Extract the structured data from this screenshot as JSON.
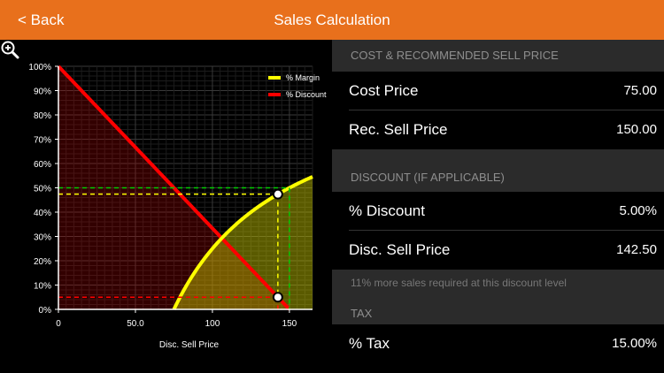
{
  "nav": {
    "back_label": "< Back",
    "title": "Sales Calculation"
  },
  "panel": {
    "cost_section": "COST & RECOMMENDED SELL PRICE",
    "cost_price_label": "Cost Price",
    "cost_price_value": "75.00",
    "rec_sell_label": "Rec. Sell Price",
    "rec_sell_value": "150.00",
    "discount_section": "DISCOUNT (IF APPLICABLE)",
    "discount_label": "% Discount",
    "discount_value": "5.00%",
    "disc_sell_label": "Disc. Sell Price",
    "disc_sell_value": "142.50",
    "note": "11% more sales required at this discount level",
    "tax_section": "TAX",
    "tax_label": "% Tax",
    "tax_value": "15.00%"
  },
  "chart_data": {
    "type": "line",
    "xlabel": "Disc. Sell Price",
    "ylabel": "",
    "x_ticks": [
      "0",
      "50.0",
      "100",
      "150"
    ],
    "x_tick_values": [
      0,
      50,
      100,
      150
    ],
    "y_ticks": [
      "0%",
      "10%",
      "20%",
      "30%",
      "40%",
      "50%",
      "60%",
      "70%",
      "80%",
      "90%",
      "100%"
    ],
    "y_tick_values": [
      0,
      10,
      20,
      30,
      40,
      50,
      60,
      70,
      80,
      90,
      100
    ],
    "xlim": [
      0,
      165
    ],
    "ylim": [
      0,
      100
    ],
    "grid": true,
    "legend_position": "top-right",
    "series": [
      {
        "name": "% Margin",
        "color": "#ffff00",
        "formula": "margin = (1 - cost/price) * 100",
        "cost": 75
      },
      {
        "name": "% Discount",
        "color": "#ff0000",
        "formula": "discount = (1 - price/150) * 100",
        "list_price": 150
      }
    ],
    "markers": [
      {
        "x": 142.5,
        "y": 47.4,
        "series": "% Margin"
      },
      {
        "x": 142.5,
        "y": 5,
        "series": "% Discount"
      }
    ],
    "reference_lines": [
      {
        "x": 150,
        "y": 50,
        "color": "#00cc00",
        "style": "dashed"
      }
    ],
    "colors": {
      "margin": "#ffff00",
      "discount": "#ff0000",
      "reference": "#00cc00"
    }
  }
}
